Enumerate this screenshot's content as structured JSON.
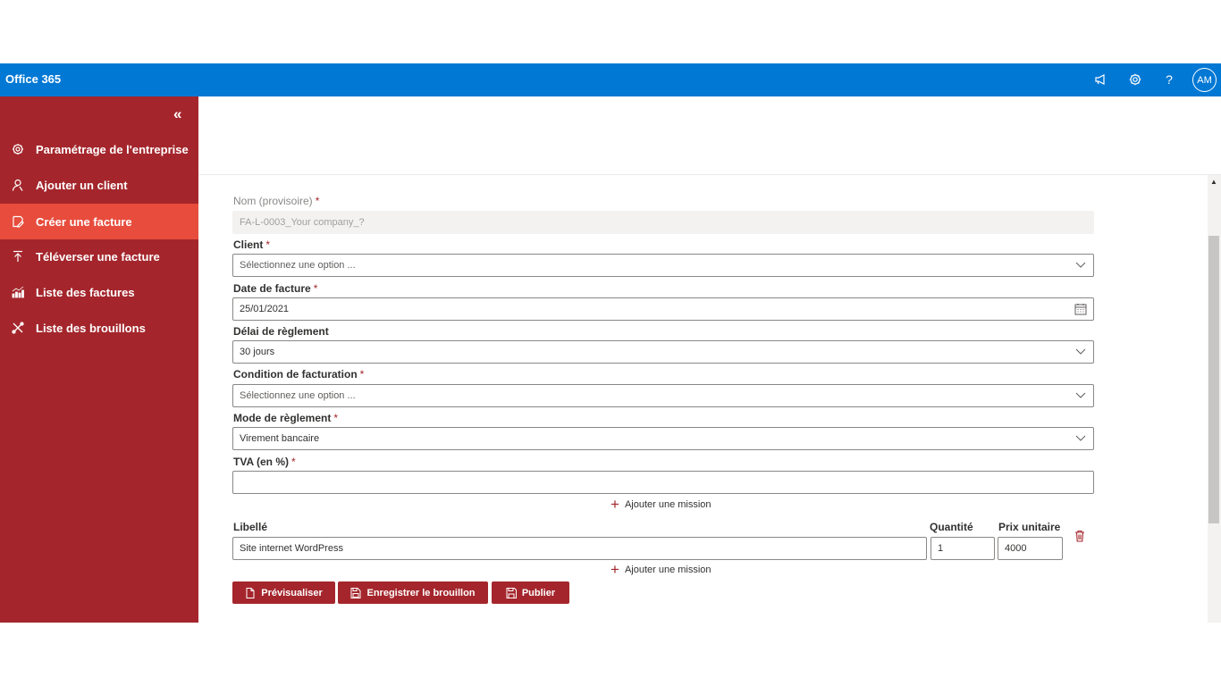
{
  "topbar": {
    "brand": "Office 365",
    "icons": [
      "megaphone-icon",
      "gear-icon",
      "help-icon"
    ],
    "help_glyph": "?",
    "avatar_initials": "AM",
    "color": "#0078d4"
  },
  "sidebar": {
    "color": "#a4262c",
    "active_color": "#e74c3c",
    "collapse_glyph": "«",
    "items": [
      {
        "label": "Paramétrage de l'entreprise",
        "icon": "gear-icon"
      },
      {
        "label": "Ajouter un client",
        "icon": "person-icon"
      },
      {
        "label": "Créer une facture",
        "icon": "edit-note-icon",
        "active": true
      },
      {
        "label": "Téléverser une facture",
        "icon": "upload-icon"
      },
      {
        "label": "Liste des factures",
        "icon": "chart-icon"
      },
      {
        "label": "Liste des brouillons",
        "icon": "tools-icon"
      }
    ]
  },
  "form": {
    "nom": {
      "label": "Nom (provisoire)",
      "required": "*",
      "value": "FA-L-0003_Your company_?"
    },
    "client": {
      "label": "Client",
      "required": "*",
      "placeholder": "Sélectionnez une option ..."
    },
    "date": {
      "label": "Date de facture",
      "required": "*",
      "value": "25/01/2021"
    },
    "delai": {
      "label": "Délai de règlement",
      "value": "30 jours"
    },
    "condition": {
      "label": "Condition de facturation",
      "required": "*",
      "placeholder": "Sélectionnez une option ..."
    },
    "mode": {
      "label": "Mode de règlement",
      "required": "*",
      "value": "Virement bancaire"
    },
    "tva": {
      "label": "TVA (en %)",
      "required": "*",
      "value": ""
    },
    "add_mission": "Ajouter une mission",
    "add_mission_glyph": "+",
    "mission": {
      "libelle_label": "Libellé",
      "quantite_label": "Quantité",
      "prix_label": "Prix unitaire",
      "libelle": "Site internet WordPress",
      "quantite": "1",
      "prix": "4000"
    }
  },
  "buttons": {
    "preview": "Prévisualiser",
    "save_draft": "Enregistrer le brouillon",
    "publish": "Publier"
  }
}
